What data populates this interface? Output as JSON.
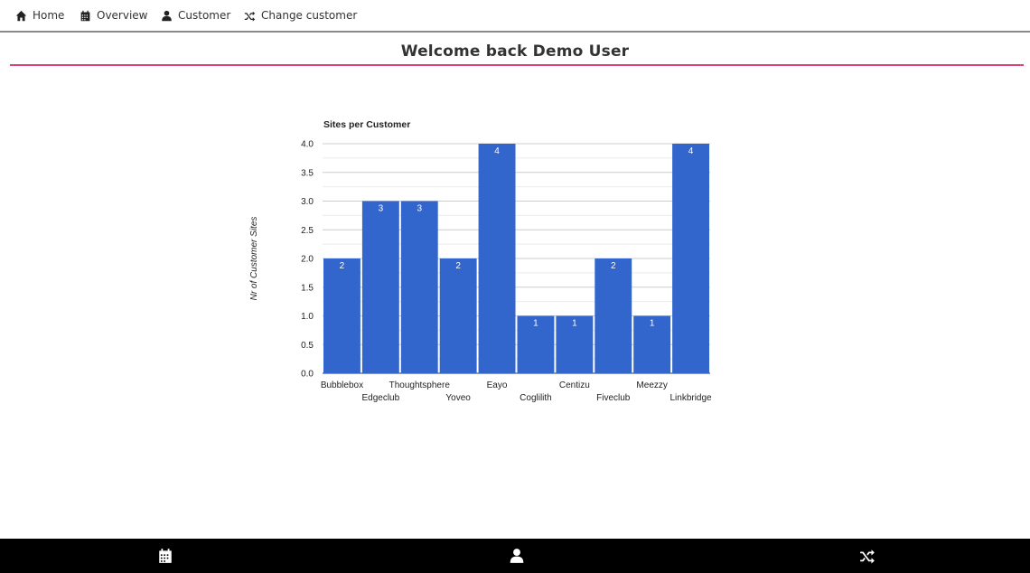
{
  "nav": {
    "items": [
      {
        "label": "Home",
        "icon": "home-icon"
      },
      {
        "label": "Overview",
        "icon": "calendar-icon"
      },
      {
        "label": "Customer",
        "icon": "user-icon"
      },
      {
        "label": "Change customer",
        "icon": "shuffle-icon"
      }
    ]
  },
  "page": {
    "title": "Welcome back Demo User",
    "accent_color": "#d6437a"
  },
  "chart_data": {
    "type": "bar",
    "title": "Sites per Customer",
    "xlabel": "",
    "ylabel": "Nr of Customer Sites",
    "categories": [
      "Bubblebox",
      "Edgeclub",
      "Thoughtsphere",
      "Yoveo",
      "Eayo",
      "Coglilith",
      "Centizu",
      "Fiveclub",
      "Meezzy",
      "Linkbridge"
    ],
    "values": [
      2,
      3,
      3,
      2,
      4,
      1,
      1,
      2,
      1,
      4
    ],
    "data_labels": [
      "2",
      "3",
      "3",
      "2",
      "4",
      "1",
      "1",
      "2",
      "1",
      "4"
    ],
    "y_ticks": [
      "0.0",
      "0.5",
      "1.0",
      "1.5",
      "2.0",
      "2.5",
      "3.0",
      "3.5",
      "4.0"
    ],
    "ylim": [
      0,
      4
    ],
    "grid": true,
    "legend": "none",
    "bar_color": "#3366cc"
  },
  "bottombar": {
    "icons": [
      "calendar-icon",
      "user-icon",
      "shuffle-icon"
    ]
  }
}
